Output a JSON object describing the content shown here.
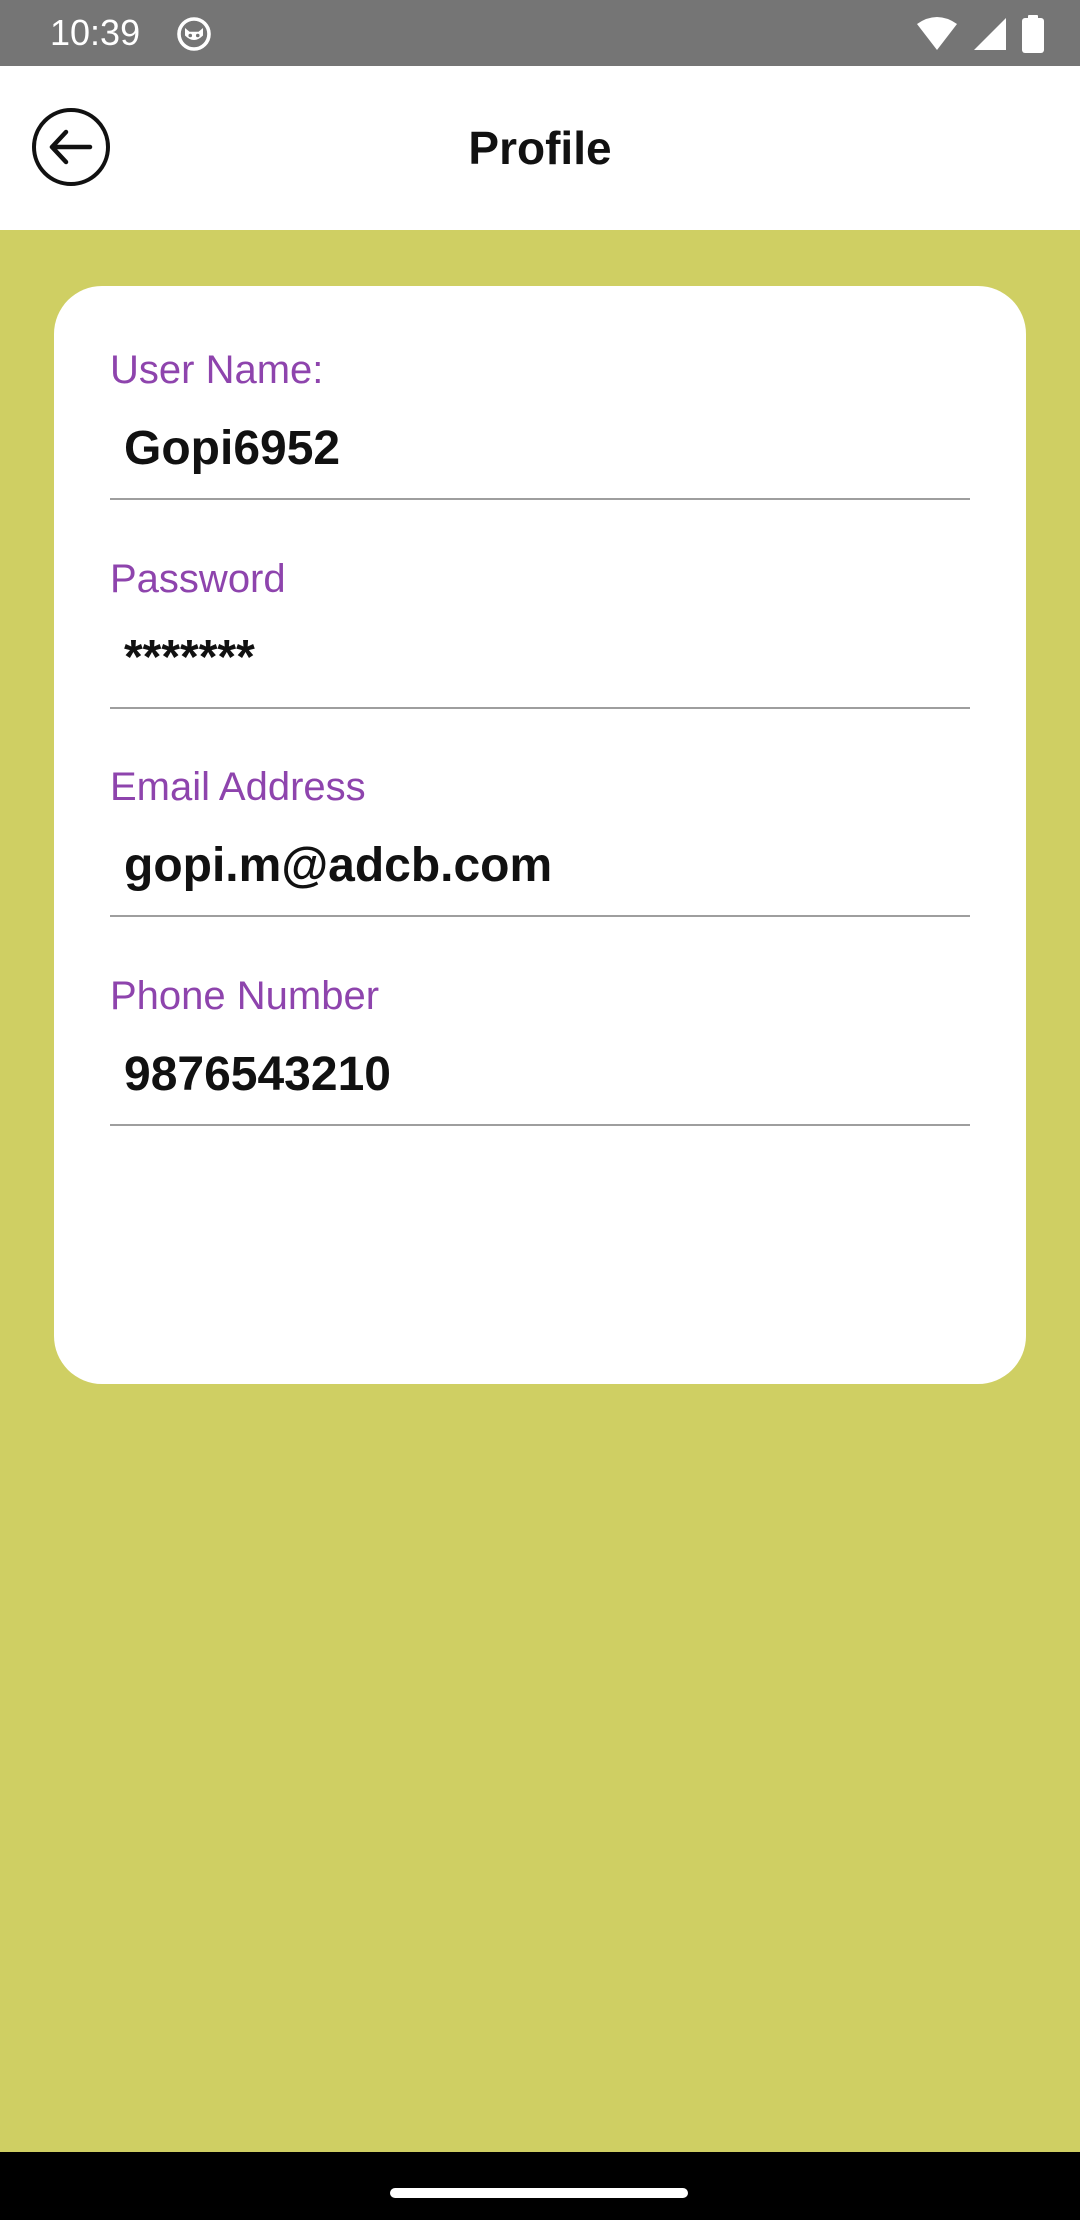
{
  "status_bar": {
    "time": "10:39",
    "icons": [
      "app-notification-icon",
      "wifi-icon",
      "signal-icon",
      "battery-icon"
    ]
  },
  "app_bar": {
    "title": "Profile",
    "back_icon": "arrow-back-circle-icon"
  },
  "profile": {
    "fields": [
      {
        "label": "User Name:",
        "value": "Gopi6952"
      },
      {
        "label": "Password",
        "value": "*******"
      },
      {
        "label": "Email Address",
        "value": "gopi.m@adcb.com"
      },
      {
        "label": "Phone Number",
        "value": "9876543210"
      }
    ]
  },
  "colors": {
    "background": "#cfcf63",
    "label": "#8e44ad",
    "status_bar": "#757575",
    "card": "#ffffff"
  }
}
